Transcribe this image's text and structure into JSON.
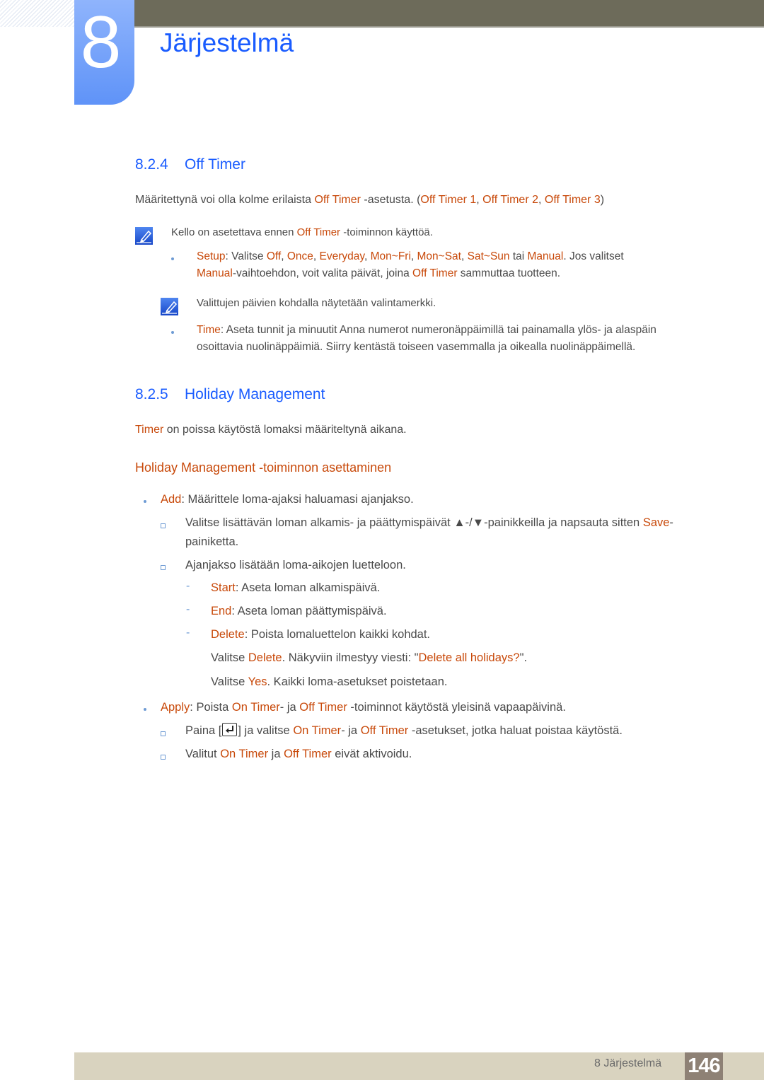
{
  "chapter": {
    "number": "8",
    "title": "Järjestelmä"
  },
  "section_824": {
    "number": "8.2.4",
    "title": "Off Timer",
    "intro": {
      "t1": "Määritettynä voi olla kolme erilaista ",
      "h1": "Off Timer",
      "t2": " -asetusta. (",
      "h2": "Off Timer 1",
      "t3": ", ",
      "h3": "Off Timer 2",
      "t4": ", ",
      "h4": "Off Timer 3",
      "t5": ")"
    },
    "note1": {
      "t1": "Kello on asetettava ennen ",
      "h1": "Off Timer",
      "t2": " -toiminnon käyttöä."
    },
    "setup": {
      "h_setup": "Setup",
      "t1": ": Valitse ",
      "h_off": "Off",
      "c1": ", ",
      "h_once": "Once",
      "c2": ", ",
      "h_everyday": "Everyday",
      "c3": ", ",
      "h_monfri": "Mon~Fri",
      "c4": ", ",
      "h_monsat": "Mon~Sat",
      "c5": ", ",
      "h_satsun": "Sat~Sun",
      "t2": " tai ",
      "h_manual": "Manual",
      "t3": ". Jos valitset",
      "h_manual2": "Manual",
      "t4": "-vaihtoehdon, voit valita päivät, joina ",
      "h_offtimer": "Off Timer",
      "t5": " sammuttaa tuotteen."
    },
    "note2": "Valittujen päivien kohdalla näytetään valintamerkki.",
    "time": {
      "h_time": "Time",
      "t1": ": Aseta tunnit ja minuutit Anna numerot numeronäppäimillä tai painamalla ylös- ja alaspäin",
      "t2": "osoittavia nuolinäppäimiä. Siirry kentästä toiseen vasemmalla ja oikealla nuolinäppäimellä."
    }
  },
  "section_825": {
    "number": "8.2.5",
    "title": "Holiday Management",
    "intro": {
      "h1": "Timer",
      "t1": " on poissa käytöstä lomaksi määriteltynä aikana."
    },
    "subheading": "Holiday Management -toiminnon asettaminen",
    "add": {
      "h_add": "Add",
      "t1": ": Määrittele loma-ajaksi haluamasi ajanjakso.",
      "sub1": {
        "t1": "Valitse lisättävän loman alkamis- ja päättymispäivät ▲-/▼-painikkeilla ja napsauta sitten ",
        "h_save": "Save",
        "t2": "-",
        "t3": "painiketta."
      },
      "sub2": "Ajanjakso lisätään loma-aikojen luetteloon.",
      "start": {
        "h": "Start",
        "t": ": Aseta loman alkamispäivä."
      },
      "end": {
        "h": "End",
        "t": ": Aseta loman päättymispäivä."
      },
      "delete": {
        "h": "Delete",
        "t": ": Poista lomaluettelon kaikki kohdat."
      },
      "delete_detail": {
        "t1": "Valitse ",
        "h1": "Delete",
        "t2": ". Näkyviin ilmestyy viesti: \"",
        "h2": "Delete all holidays?",
        "t3": "\"."
      },
      "yes_detail": {
        "t1": "Valitse ",
        "h1": "Yes",
        "t2": ". Kaikki loma-asetukset poistetaan."
      }
    },
    "apply": {
      "h_apply": "Apply",
      "t1": ": Poista ",
      "h_on": "On Timer",
      "t2": "- ja ",
      "h_off": "Off Timer",
      "t3": " -toiminnot käytöstä yleisinä vapaapäivinä.",
      "sub1": {
        "t1": "Paina [",
        "t2": "] ja valitse ",
        "h_on": "On Timer",
        "t3": "- ja ",
        "h_off": "Off Timer",
        "t4": " -asetukset, jotka haluat poistaa käytöstä."
      },
      "sub2": {
        "t1": "Valitut ",
        "h_on": "On Timer",
        "t2": " ja ",
        "h_off": "Off Timer",
        "t3": " eivät aktivoidu."
      }
    }
  },
  "footer": {
    "chapter_label": "8 Järjestelmä",
    "page_number": "146"
  },
  "colors": {
    "heading_blue": "#1a5cff",
    "highlight_orange": "#c8490a",
    "topbar": "#6d6b5a",
    "footer": "#d9d3bf",
    "page_badge": "#8e8175"
  }
}
